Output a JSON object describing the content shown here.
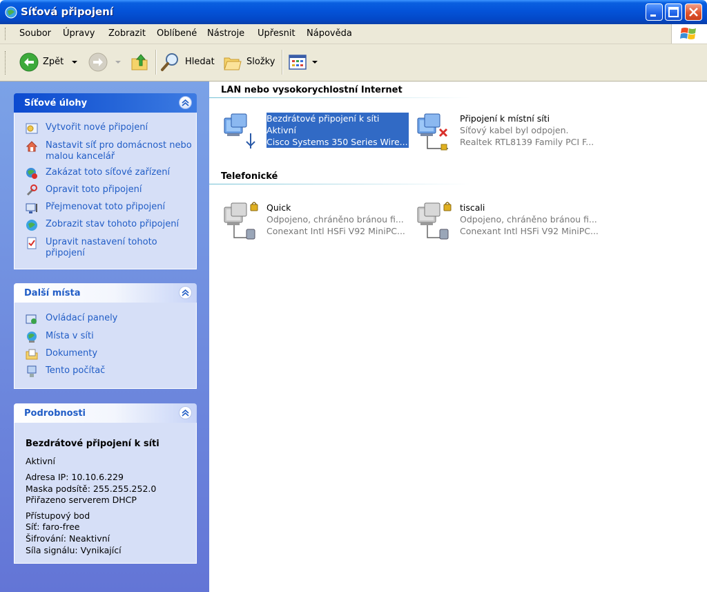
{
  "window": {
    "title": "Síťová připojení",
    "icon": "network-connections-icon"
  },
  "menu": [
    "Soubor",
    "Úpravy",
    "Zobrazit",
    "Oblíbené",
    "Nástroje",
    "Upřesnit",
    "Nápověda"
  ],
  "toolbar": {
    "back_label": "Zpět",
    "search_label": "Hledat",
    "folders_label": "Složky"
  },
  "panels": {
    "tasks": {
      "title": "Síťové úlohy",
      "items": [
        {
          "label": "Vytvořit nové připojení",
          "icon": "new-connection-icon"
        },
        {
          "label": "Nastavit síť pro domácnost nebo malou kancelář",
          "icon": "home-network-icon"
        },
        {
          "label": "Zakázat toto síťové zařízení",
          "icon": "disable-device-icon"
        },
        {
          "label": "Opravit toto připojení",
          "icon": "repair-icon"
        },
        {
          "label": "Přejmenovat toto připojení",
          "icon": "rename-icon"
        },
        {
          "label": "Zobrazit stav tohoto připojení",
          "icon": "status-icon"
        },
        {
          "label": "Upravit nastavení tohoto připojení",
          "icon": "settings-icon"
        }
      ]
    },
    "other_places": {
      "title": "Další místa",
      "items": [
        {
          "label": "Ovládací panely",
          "icon": "control-panel-icon"
        },
        {
          "label": "Místa v síti",
          "icon": "network-places-icon"
        },
        {
          "label": "Dokumenty",
          "icon": "documents-icon"
        },
        {
          "label": "Tento počítač",
          "icon": "my-computer-icon"
        }
      ]
    },
    "details": {
      "title": "Podrobnosti",
      "name": "Bezdrátové připojení k síti",
      "status": "Aktivní",
      "ip": "Adresa IP: 10.10.6.229",
      "mask": "Maska podsítě: 255.255.252.0",
      "dhcp": "Přiřazeno serverem DHCP",
      "ap": "Přístupový bod",
      "ssid": "Síť: faro-free",
      "encryption": "Šifrování: Neaktivní",
      "signal": "Síla signálu: Vynikající"
    }
  },
  "groups": {
    "lan": {
      "title": "LAN nebo vysokorychlostní Internet",
      "items": [
        {
          "name": "Bezdrátové připojení k síti",
          "status": "Aktivní",
          "device": "Cisco Systems 350 Series Wire...",
          "selected": true
        },
        {
          "name": "Připojení k místní síti",
          "status": "Síťový kabel byl odpojen.",
          "device": "Realtek RTL8139 Family PCI F..."
        }
      ]
    },
    "dialup": {
      "title": "Telefonické",
      "items": [
        {
          "name": "Quick",
          "status": "Odpojeno, chráněno bránou fi...",
          "device": "Conexant Intl HSFi V92 MiniPC..."
        },
        {
          "name": "tiscali",
          "status": "Odpojeno, chráněno bránou fi...",
          "device": "Conexant Intl HSFi V92 MiniPC..."
        }
      ]
    }
  }
}
